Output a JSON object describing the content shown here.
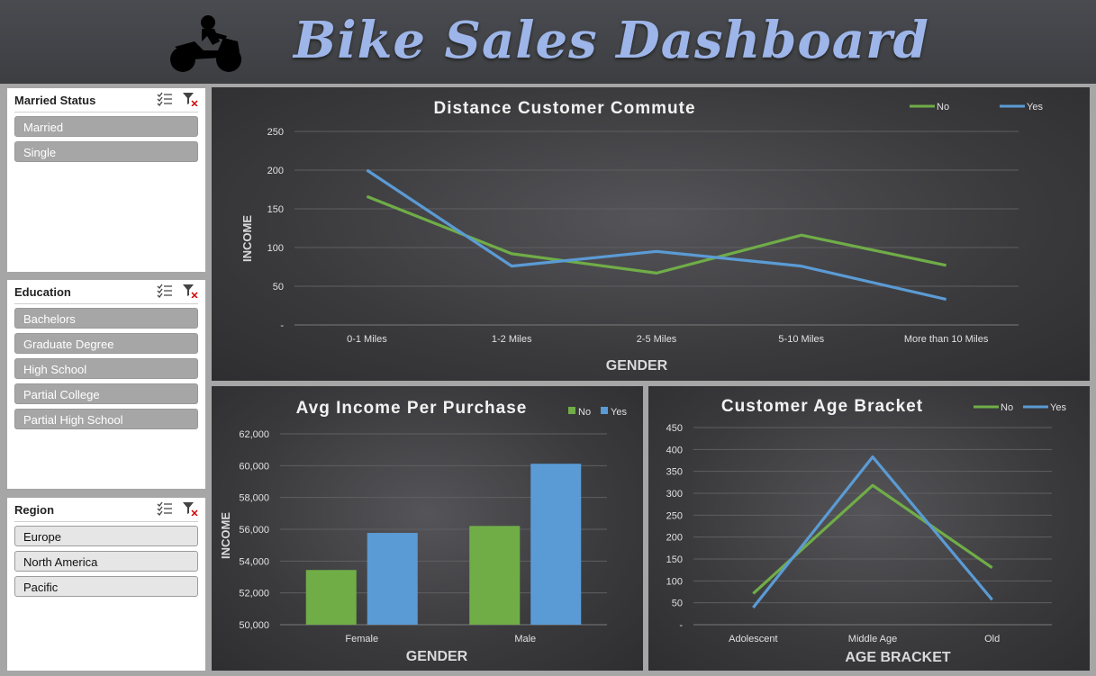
{
  "header": {
    "title": "Bike Sales Dashboard"
  },
  "slicers": {
    "married": {
      "title": "Married Status",
      "items": [
        "Married",
        "Single"
      ]
    },
    "education": {
      "title": "Education",
      "items": [
        "Bachelors",
        "Graduate Degree",
        "High School",
        "Partial College",
        "Partial High School"
      ]
    },
    "region": {
      "title": "Region",
      "items": [
        "Europe",
        "North America",
        "Pacific"
      ]
    }
  },
  "colors": {
    "no": "#70ad47",
    "yes": "#5b9bd5"
  },
  "chart_data": [
    {
      "type": "line",
      "title": "Distance  Customer Commute",
      "xlabel": "GENDER",
      "ylabel": "INCOME",
      "categories": [
        "0-1 Miles",
        "1-2 Miles",
        "2-5 Miles",
        "5-10 Miles",
        "More than 10 Miles"
      ],
      "series": [
        {
          "name": "No",
          "values": [
            166,
            92,
            67,
            116,
            77
          ]
        },
        {
          "name": "Yes",
          "values": [
            200,
            76,
            95,
            76,
            33
          ]
        }
      ],
      "ylim": [
        0,
        250
      ],
      "yticks": [
        "-",
        "50",
        "100",
        "150",
        "200",
        "250"
      ],
      "grid": true,
      "legend": "top-right"
    },
    {
      "type": "bar",
      "title": "Avg Income Per Purchase",
      "xlabel": "GENDER",
      "ylabel": "INCOME",
      "categories": [
        "Female",
        "Male"
      ],
      "series": [
        {
          "name": "No",
          "values": [
            53440,
            56210
          ]
        },
        {
          "name": "Yes",
          "values": [
            55770,
            60120
          ]
        }
      ],
      "ylim": [
        50000,
        62000
      ],
      "yticks": [
        "50,000",
        "52,000",
        "54,000",
        "56,000",
        "58,000",
        "60,000",
        "62,000"
      ],
      "grid": true,
      "legend": "top-right"
    },
    {
      "type": "line",
      "title": "Customer Age Bracket",
      "xlabel": "AGE BRACKET",
      "ylabel": "",
      "categories": [
        "Adolescent",
        "Middle Age",
        "Old"
      ],
      "series": [
        {
          "name": "No",
          "values": [
            71,
            318,
            130
          ]
        },
        {
          "name": "Yes",
          "values": [
            39,
            383,
            57
          ]
        }
      ],
      "ylim": [
        0,
        450
      ],
      "yticks": [
        "-",
        "50",
        "100",
        "150",
        "200",
        "250",
        "300",
        "350",
        "400",
        "450"
      ],
      "grid": true,
      "legend": "top-right"
    }
  ]
}
